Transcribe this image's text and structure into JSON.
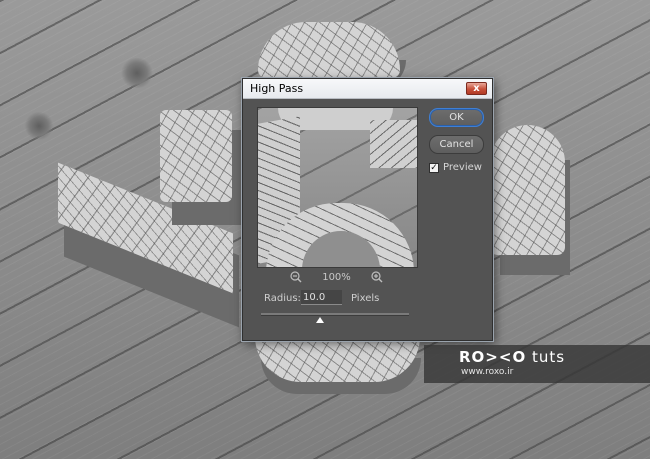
{
  "dialog": {
    "title": "High Pass",
    "close_glyph": "x",
    "ok_label": "OK",
    "cancel_label": "Cancel",
    "preview_label": "Preview",
    "preview_checked": true,
    "zoom_out_icon": "zoom-out-icon",
    "zoom_in_icon": "zoom-in-icon",
    "zoom_value": "100%",
    "radius_label": "Radius:",
    "radius_value": "10.0",
    "unit_label": "Pixels",
    "slider_icon": "slider-thumb-icon",
    "accent_color": "#3f7fd4"
  },
  "watermark": {
    "brand": "RO><O",
    "tag": "tuts",
    "url": "www.roxo.ir"
  }
}
